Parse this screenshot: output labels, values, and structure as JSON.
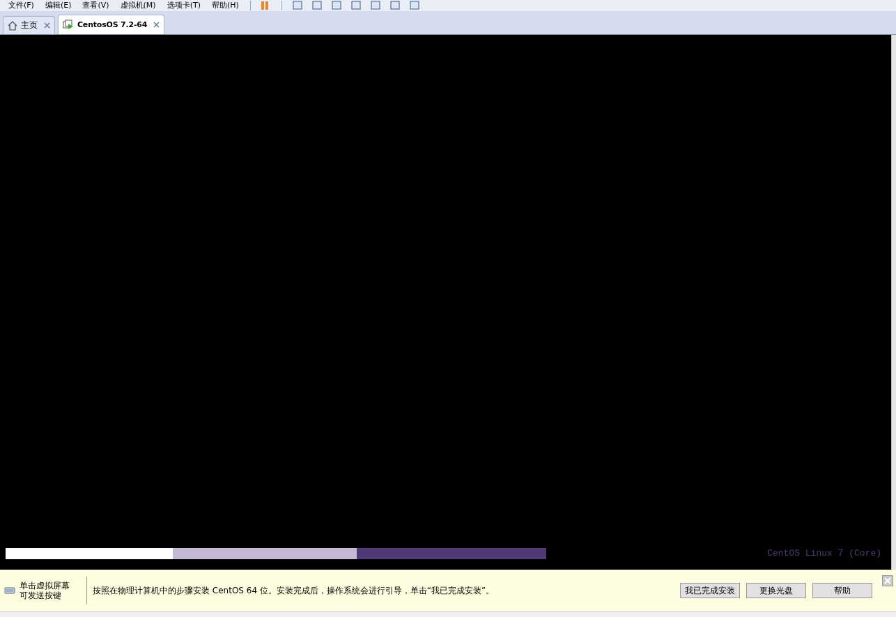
{
  "menu": [
    "文件(F)",
    "编辑(E)",
    "查看(V)",
    "虚拟机(M)",
    "选项卡(T)",
    "帮助(H)"
  ],
  "tabs": [
    {
      "label": "主页",
      "kind": "home",
      "selected": false
    },
    {
      "label": "CentosOS 7.2-64",
      "kind": "vm",
      "selected": true
    }
  ],
  "console": {
    "os_label": "CentOS Linux 7 (Core)"
  },
  "hint_bar": {
    "keyboard_hint": [
      "单击虚拟屏幕",
      "可发送按键"
    ],
    "message": "按照在物理计算机中的步骤安装 CentOS 64 位。安装完成后，操作系统会进行引导，单击“我已完成安装”。",
    "buttons": [
      "我已完成安装",
      "更换光盘",
      "帮助"
    ]
  }
}
